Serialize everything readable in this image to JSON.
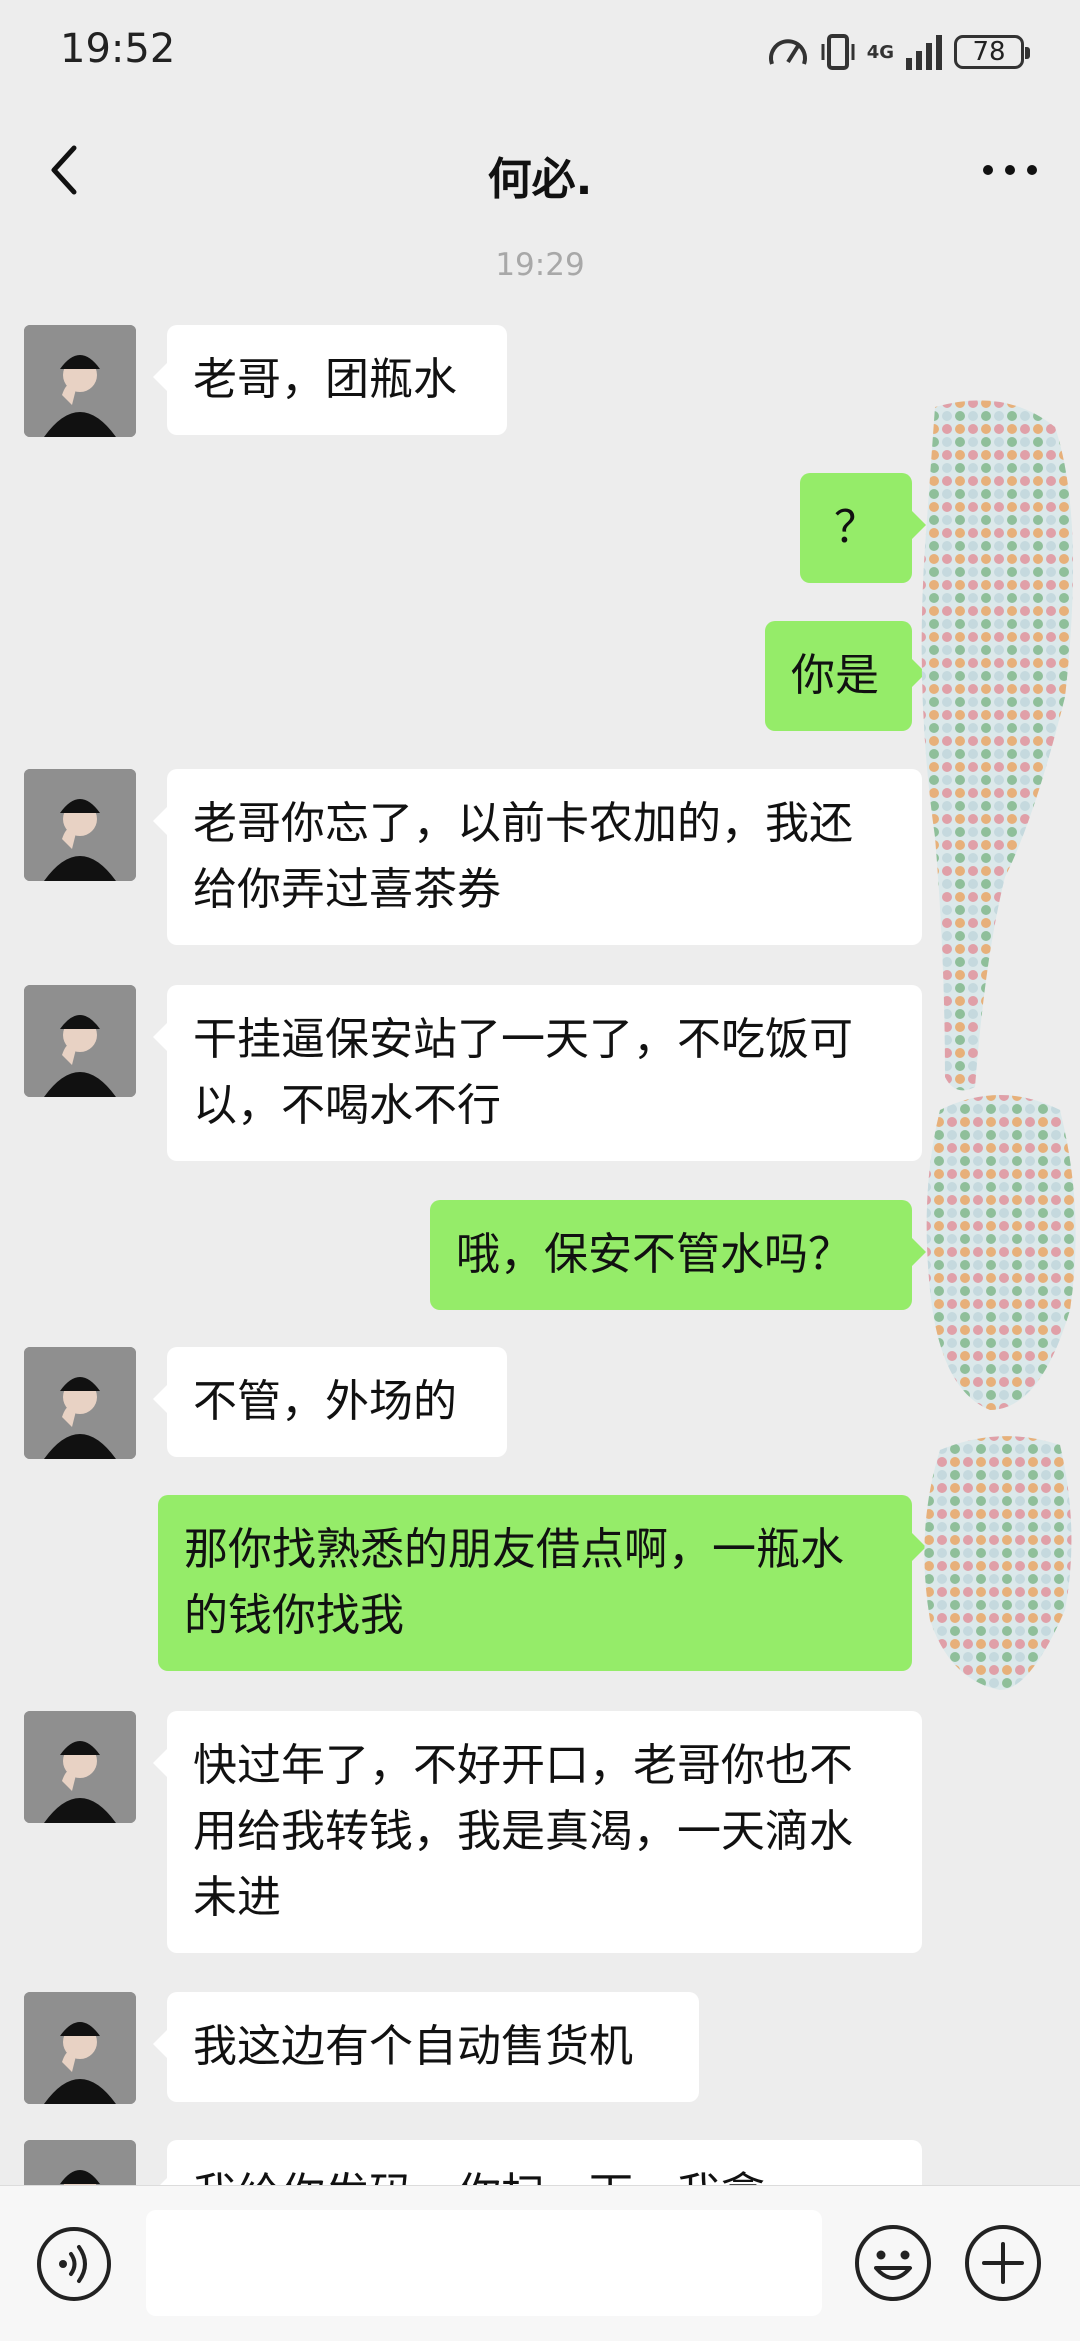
{
  "status_bar": {
    "time": "19:52",
    "network": "4G",
    "battery": "78"
  },
  "header": {
    "title": "何必."
  },
  "chat": {
    "timestamp": "19:29",
    "messages": [
      {
        "from": "them",
        "text": "老哥，团瓶水"
      },
      {
        "from": "me",
        "text": "？"
      },
      {
        "from": "me",
        "text": "你是"
      },
      {
        "from": "them",
        "text": "老哥你忘了，以前卡农加的，我还给你弄过喜茶券"
      },
      {
        "from": "them",
        "text": "干挂逼保安站了一天了，不吃饭可以，不喝水不行"
      },
      {
        "from": "me",
        "text": "哦，保安不管水吗？"
      },
      {
        "from": "them",
        "text": "不管，外场的"
      },
      {
        "from": "me",
        "text": "那你找熟悉的朋友借点啊，一瓶水的钱你找我"
      },
      {
        "from": "them",
        "text": "快过年了，不好开口，老哥你也不用给我转钱，我是真渴，一天滴水未进"
      },
      {
        "from": "them",
        "text": "我这边有个自动售货机"
      },
      {
        "from": "them",
        "text": "我给你发码，你扫一下，我拿"
      }
    ]
  },
  "input_bar": {
    "message_value": ""
  },
  "colors": {
    "outgoing_bubble": "#95ec69",
    "incoming_bubble": "#ffffff",
    "background": "#ededed"
  }
}
